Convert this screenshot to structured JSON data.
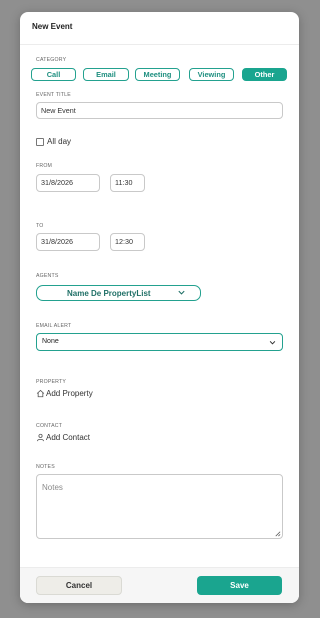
{
  "dialog": {
    "title": "New Event"
  },
  "category": {
    "label": "CATEGORY",
    "options": [
      "Call",
      "Email",
      "Meeting",
      "Viewing",
      "Other"
    ],
    "selected": "Other"
  },
  "event_title": {
    "label": "EVENT TITLE",
    "value": "New Event"
  },
  "all_day": {
    "label": "All day",
    "checked": false
  },
  "from": {
    "label": "FROM",
    "date": "31/8/2026",
    "time": "11:30"
  },
  "to": {
    "label": "TO",
    "date": "31/8/2026",
    "time": "12:30"
  },
  "agents": {
    "label": "AGENTS",
    "value": "Name De PropertyList"
  },
  "email_alert": {
    "label": "EMAIL ALERT",
    "value": "None"
  },
  "property": {
    "label": "PROPERTY",
    "action": "Add Property"
  },
  "contact": {
    "label": "CONTACT",
    "action": "Add Contact"
  },
  "notes": {
    "label": "NOTES",
    "placeholder": "Notes"
  },
  "footer": {
    "cancel_label": "Cancel",
    "save_label": "Save"
  },
  "colors": {
    "accent": "#1aa58f",
    "overlay": "#8f8f8f"
  }
}
